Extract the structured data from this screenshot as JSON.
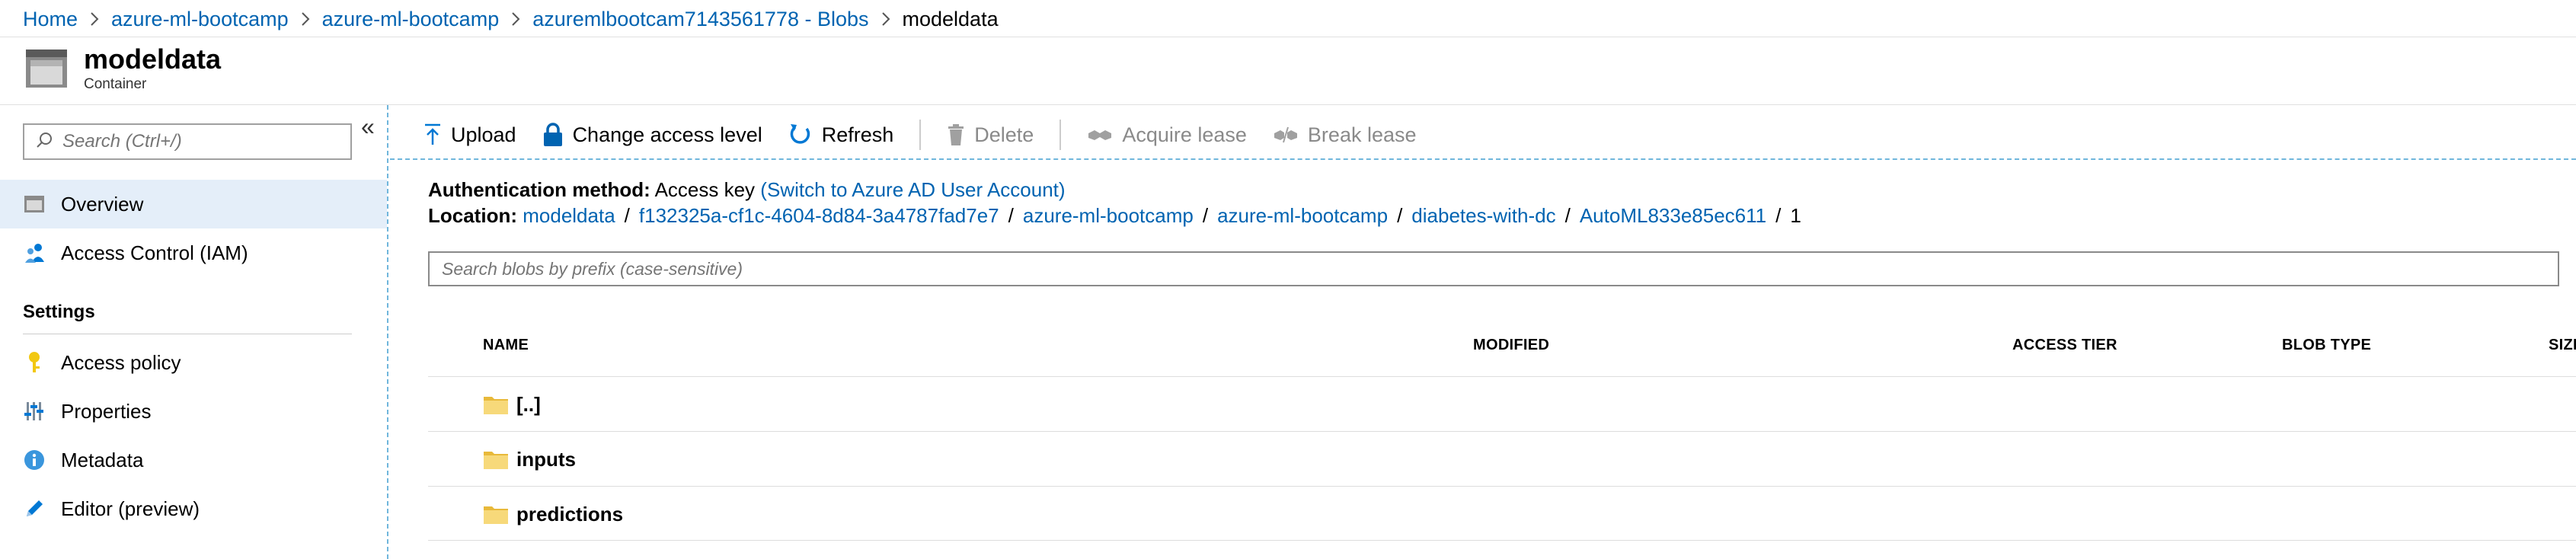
{
  "breadcrumb": {
    "items": [
      "Home",
      "azure-ml-bootcamp",
      "azure-ml-bootcamp",
      "azuremlbootcam7143561778 - Blobs"
    ],
    "current": "modeldata"
  },
  "header": {
    "title": "modeldata",
    "subtitle": "Container"
  },
  "sidebar": {
    "search_placeholder": "Search (Ctrl+/)",
    "items": [
      {
        "label": "Overview",
        "icon": "container-icon",
        "active": true
      },
      {
        "label": "Access Control (IAM)",
        "icon": "people-icon",
        "active": false
      }
    ],
    "settings_label": "Settings",
    "settings_items": [
      {
        "label": "Access policy",
        "icon": "key-icon"
      },
      {
        "label": "Properties",
        "icon": "sliders-icon"
      },
      {
        "label": "Metadata",
        "icon": "info-icon"
      },
      {
        "label": "Editor (preview)",
        "icon": "pencil-icon"
      }
    ]
  },
  "toolbar": {
    "upload": "Upload",
    "change_access": "Change access level",
    "refresh": "Refresh",
    "delete": "Delete",
    "acquire_lease": "Acquire lease",
    "break_lease": "Break lease"
  },
  "auth": {
    "label": "Authentication method:",
    "value": "Access key",
    "switch_link": "(Switch to Azure AD User Account)"
  },
  "location": {
    "label": "Location:",
    "path": [
      "modeldata",
      "f132325a-cf1c-4604-8d84-3a4787fad7e7",
      "azure-ml-bootcamp",
      "azure-ml-bootcamp",
      "diabetes-with-dc",
      "AutoML833e85ec611"
    ],
    "last": "1"
  },
  "blob_search": {
    "placeholder": "Search blobs by prefix (case-sensitive)"
  },
  "table": {
    "columns": [
      "NAME",
      "MODIFIED",
      "ACCESS TIER",
      "BLOB TYPE",
      "SIZE"
    ],
    "rows": [
      {
        "name": "[..]"
      },
      {
        "name": "inputs"
      },
      {
        "name": "predictions"
      }
    ]
  },
  "colors": {
    "link": "#0063b1",
    "active_bg": "#e4eef9",
    "dashed_border": "#70b6dc",
    "folder": "#f7d97a"
  }
}
